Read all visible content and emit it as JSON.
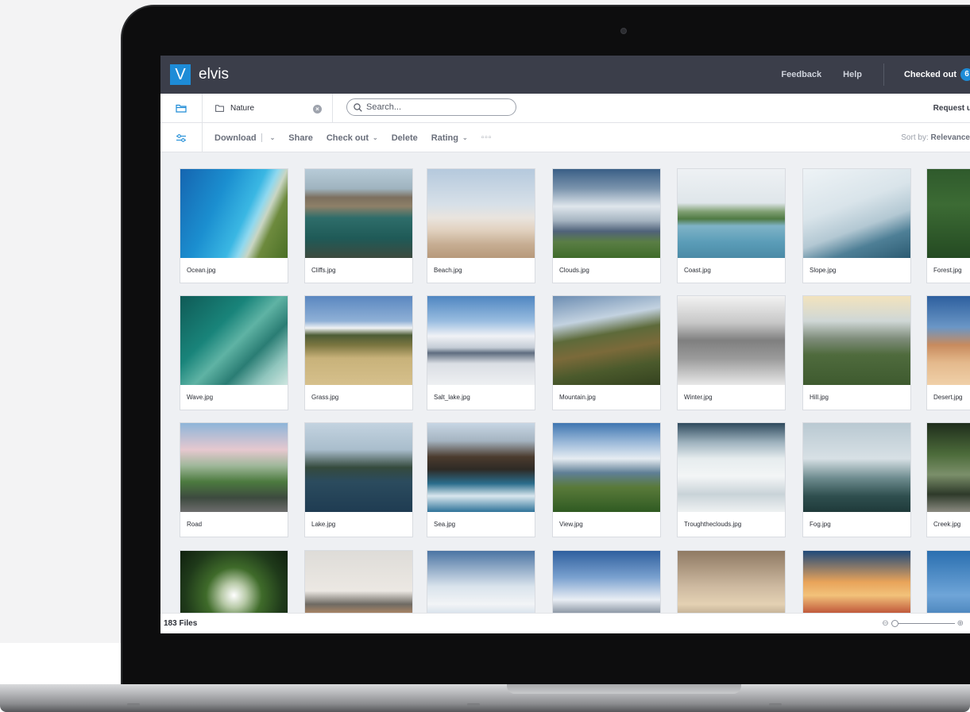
{
  "app": {
    "logo_letter": "V",
    "name": "elvis",
    "accent": "#1e8cd7",
    "header_bg": "#3b3e4a"
  },
  "header": {
    "feedback": "Feedback",
    "help": "Help",
    "checked_out_label": "Checked out",
    "checked_out_count": "6"
  },
  "navbar": {
    "folder_icon": "folder-icon",
    "collection_icon": "folder-icon",
    "collection_name": "Nature",
    "clear_icon": "clear-icon",
    "search_icon": "search-icon",
    "search_placeholder": "Search...",
    "request_label": "Request u"
  },
  "toolbar": {
    "filter_icon": "filter-sliders-icon",
    "download": "Download",
    "share": "Share",
    "check_out": "Check out",
    "delete": "Delete",
    "rating": "Rating",
    "more": "more-icon",
    "sort_label": "Sort by:",
    "sort_value": "Relevance"
  },
  "files": [
    [
      "Ocean.jpg",
      "Cliffs.jpg",
      "Beach.jpg",
      "Clouds.jpg",
      "Coast.jpg",
      "Slope.jpg",
      "Forest.jpg"
    ],
    [
      "Wave.jpg",
      "Grass.jpg",
      "Salt_lake.jpg",
      "Mountain.jpg",
      "Winter.jpg",
      "Hill.jpg",
      "Desert.jpg"
    ],
    [
      "Road",
      "Lake.jpg",
      "Sea.jpg",
      "View.jpg",
      "Troughtheclouds.jpg",
      "Fog.jpg",
      "Creek.jpg"
    ],
    [
      "",
      "",
      "",
      "",
      "",
      "",
      ""
    ]
  ],
  "status": {
    "files_count": "183 Files",
    "zoom_out_icon": "zoom-out-icon",
    "zoom_in_icon": "zoom-in-icon",
    "zoom_level": 0.0
  }
}
